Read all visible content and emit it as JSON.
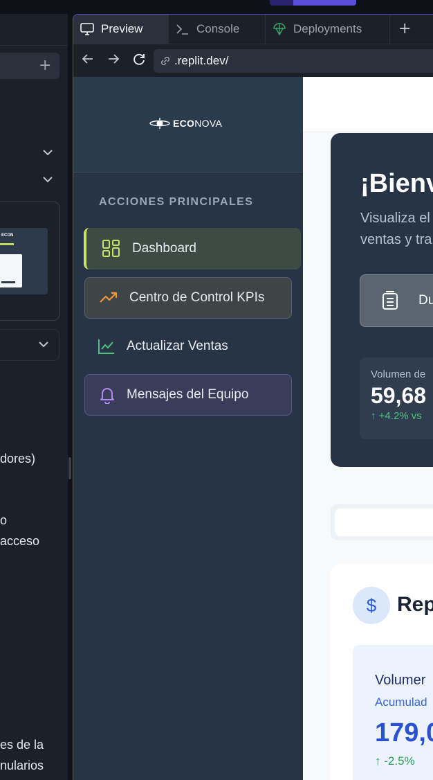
{
  "ide": {
    "left_texts": [
      "dores)",
      "o",
      "acceso",
      "es de la",
      "nularios"
    ]
  },
  "tabs": [
    {
      "label": "Preview",
      "icon": "monitor-icon"
    },
    {
      "label": "Console",
      "icon": "terminal-icon"
    },
    {
      "label": "Deployments",
      "icon": "deploy-icon"
    }
  ],
  "url": {
    "value": ".replit.dev/"
  },
  "sidebar": {
    "logo_bold": "ECO",
    "logo_rest": "NOVA",
    "section_title": "ACCIONES PRINCIPALES",
    "items": [
      {
        "label": "Dashboard",
        "icon": "grid-icon"
      },
      {
        "label": "Centro de Control KPIs",
        "icon": "trend-up-icon"
      },
      {
        "label": "Actualizar Ventas",
        "icon": "line-chart-icon"
      },
      {
        "label": "Mensajes del Equipo",
        "icon": "bell-icon"
      }
    ]
  },
  "hero": {
    "title": "¡Bienv",
    "subtitle_line1": "Visualiza el",
    "subtitle_line2": "ventas y tra",
    "button_label": "Du",
    "volume_label": "Volumen de",
    "volume_value": "59,68",
    "volume_change": "+4.2% vs"
  },
  "report": {
    "icon_glyph": "$",
    "title": "Rep",
    "card_title": "Volumer",
    "card_subtitle": "Acumulad",
    "card_value": "179,0",
    "card_change": "-2.5%"
  },
  "colors": {
    "accent_active": "#c8e36a",
    "sidebar_bg": "#263446",
    "positive": "#4fc37e",
    "report_blue": "#2a52d0"
  }
}
